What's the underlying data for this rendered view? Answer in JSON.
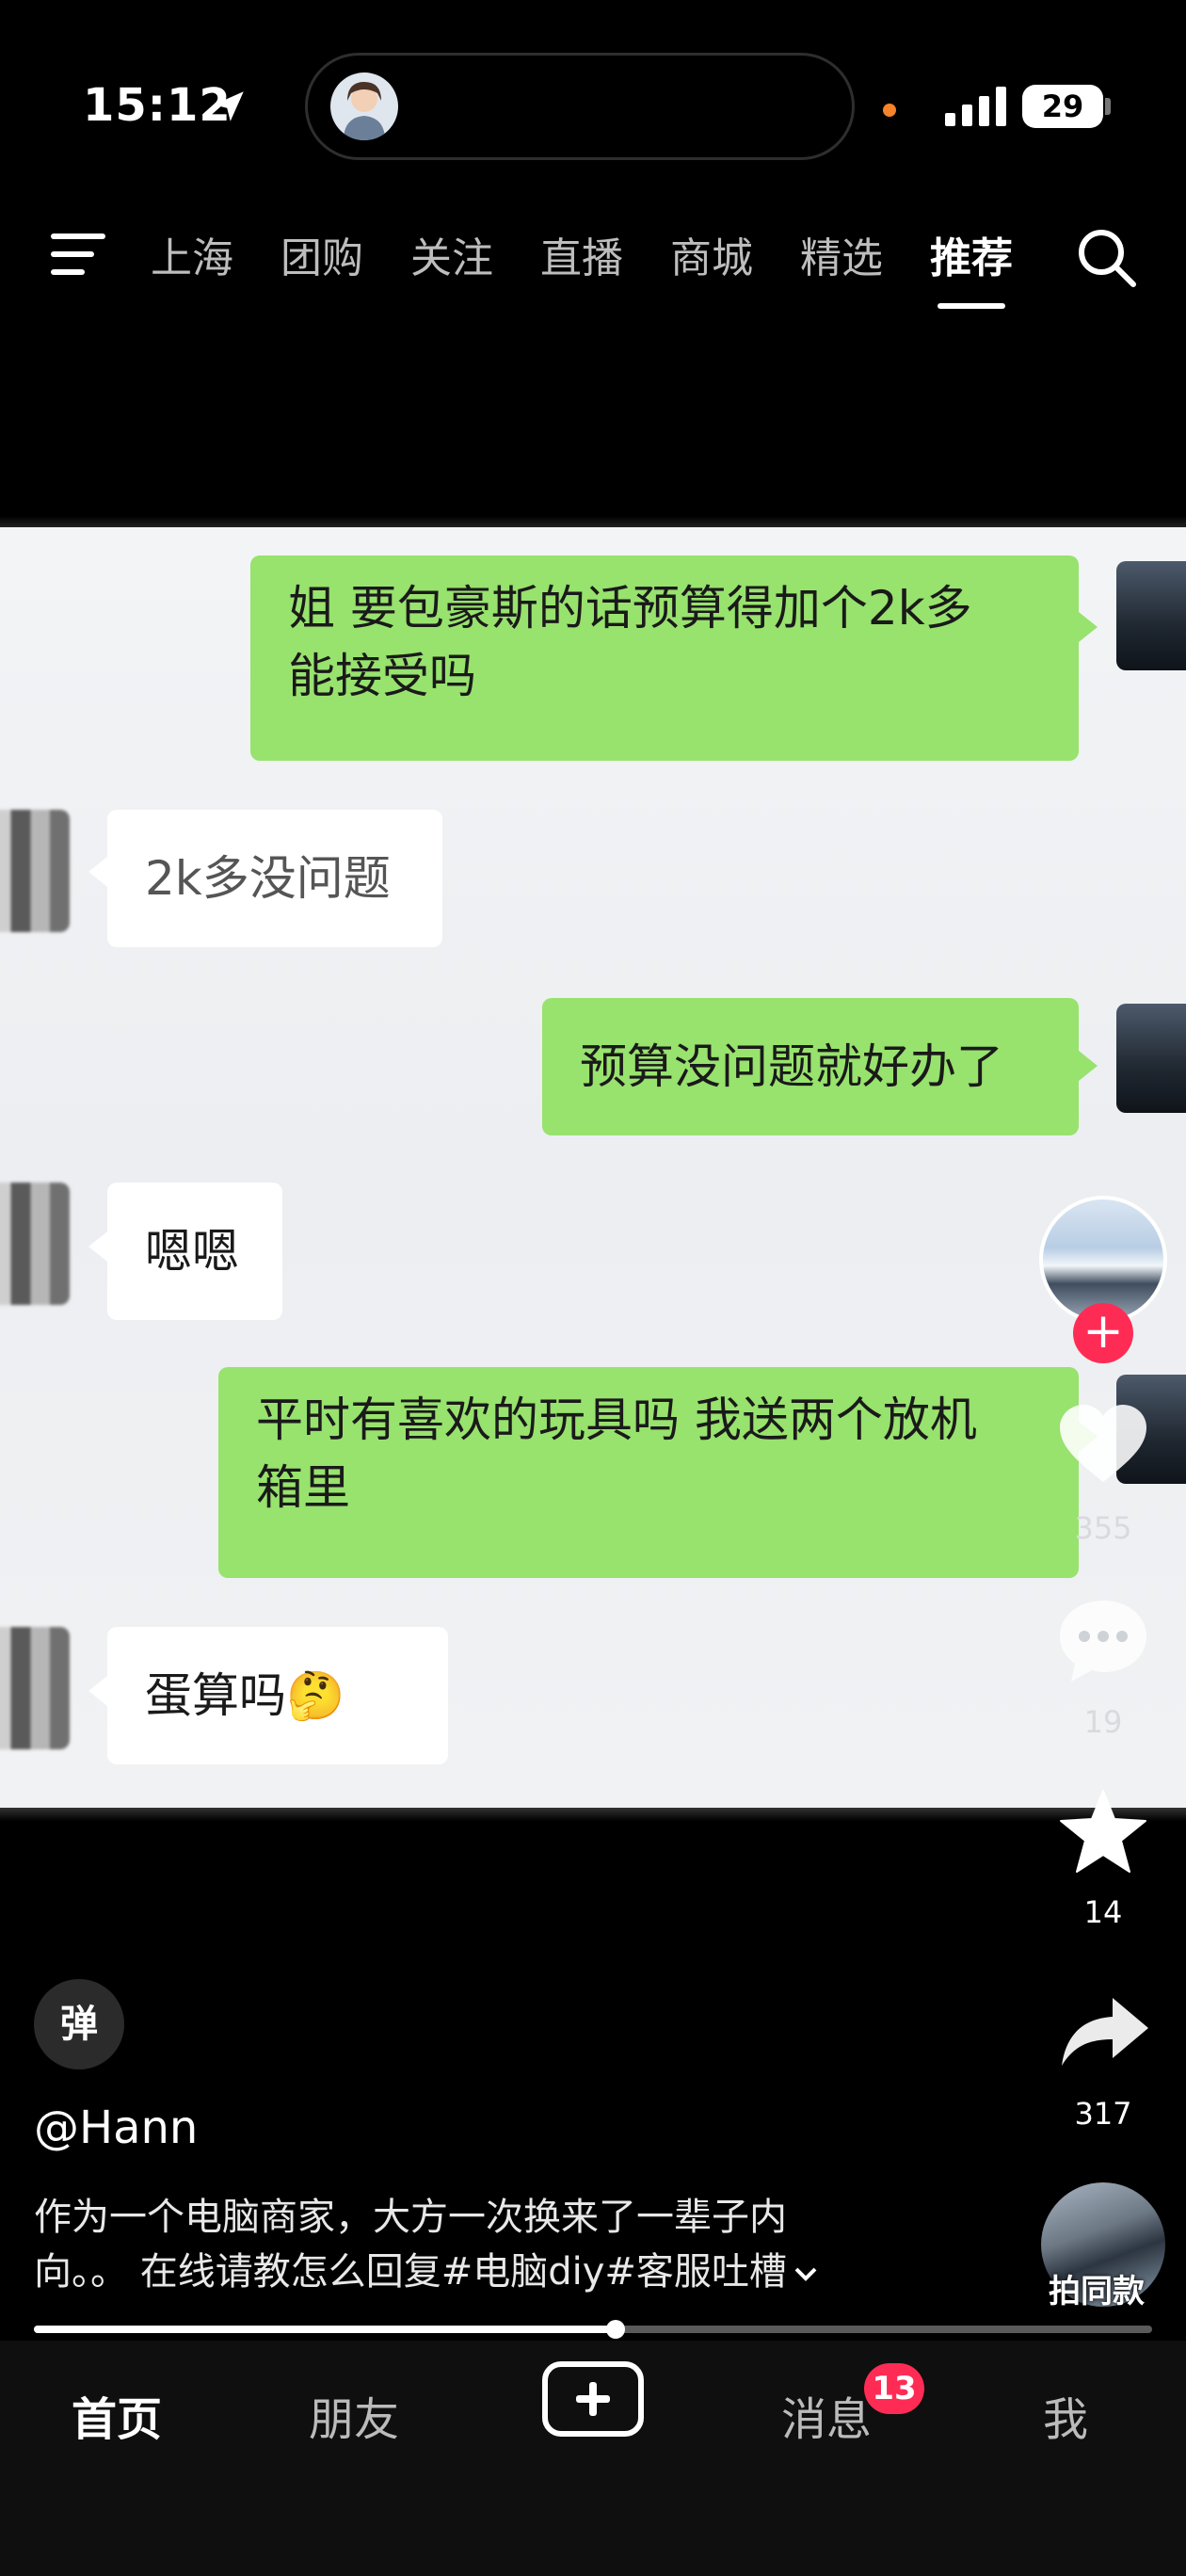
{
  "status": {
    "time": "15:12",
    "battery": "29"
  },
  "nav": {
    "tabs": [
      {
        "label": "上海"
      },
      {
        "label": "团购"
      },
      {
        "label": "关注"
      },
      {
        "label": "直播"
      },
      {
        "label": "商城"
      },
      {
        "label": "精选"
      },
      {
        "label": "推荐"
      }
    ],
    "active_tab": "推荐"
  },
  "chat": {
    "messages": [
      {
        "side": "me",
        "lines": [
          "姐 要包豪斯的话预算得加个2k多",
          "能接受吗"
        ]
      },
      {
        "side": "them",
        "lines": [
          "2k多没问题"
        ]
      },
      {
        "side": "me",
        "lines": [
          "预算没问题就好办了"
        ]
      },
      {
        "side": "them",
        "lines": [
          "嗯嗯"
        ]
      },
      {
        "side": "me",
        "lines": [
          "平时有喜欢的玩具吗 我送两个放机",
          "箱里"
        ]
      },
      {
        "side": "them",
        "lines": [
          "蛋算吗🤔"
        ]
      }
    ]
  },
  "actions": {
    "likes": "355",
    "comments": "19",
    "favorites": "14",
    "shares": "317"
  },
  "post": {
    "danmu_label": "弹",
    "username": "@Hann",
    "caption_line1": "作为一个电脑商家，大方一次换来了一辈子内",
    "caption_line2": "向。。 在线请教怎么回复#电脑diy#客服吐槽",
    "same_style_label": "拍同款",
    "progress": 0.52
  },
  "tabbar": {
    "home": "首页",
    "friends": "朋友",
    "messages": "消息",
    "messages_badge": "13",
    "me": "我"
  },
  "colors": {
    "accent_red": "#fe2c55",
    "wechat_green": "#98e26e"
  },
  "icons": [
    "location-arrow-icon",
    "menu-icon",
    "search-icon",
    "heart-icon",
    "comment-icon",
    "star-icon",
    "share-icon",
    "plus-icon"
  ]
}
